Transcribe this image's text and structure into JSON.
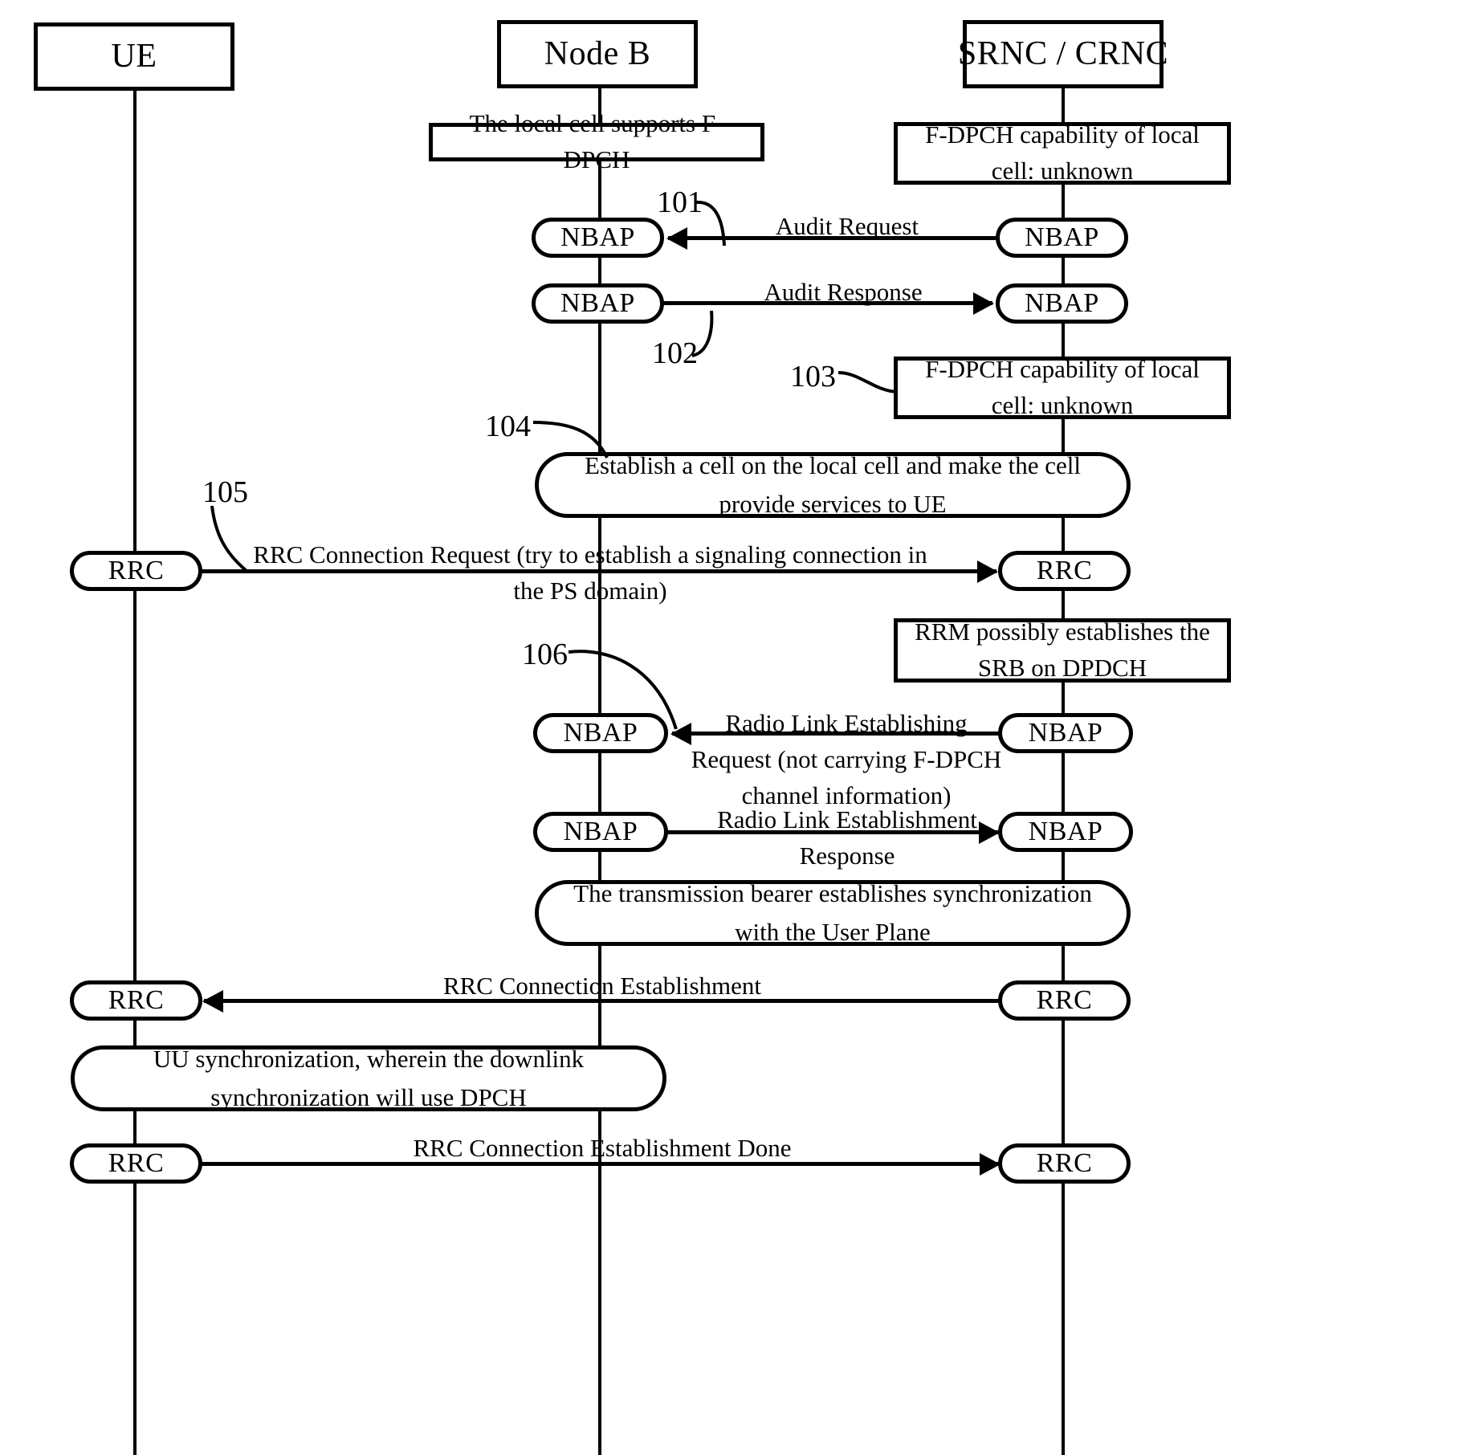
{
  "figure": {
    "type": "sequence-diagram",
    "title": "",
    "background_color": "#ffffff",
    "line_color": "#000000"
  },
  "actors": [
    {
      "id": "ue",
      "label": "UE"
    },
    {
      "id": "nodeb",
      "label": "Node B"
    },
    {
      "id": "rnc",
      "label": "SRNC / CRNC"
    }
  ],
  "notes": [
    {
      "id": "note-nodeb-fdpch",
      "text": "The local cell supports F-DPCH"
    },
    {
      "id": "note-rnc-cap-1",
      "text": "F-DPCH capability of local cell: unknown"
    },
    {
      "id": "note-rnc-cap-2",
      "text": "F-DPCH capability of local cell: unknown"
    },
    {
      "id": "note-rnc-rrm",
      "text": "RRM possibly establishes the SRB on DPDCH"
    }
  ],
  "actions": [
    {
      "id": "action-establish-cell",
      "text": "Establish a cell on the local cell and make the cell provide services to UE"
    },
    {
      "id": "action-transport-sync",
      "text": "The transmission bearer establishes synchronization with the User Plane"
    },
    {
      "id": "action-uu-sync",
      "text": "UU synchronization, wherein the downlink synchronization will use DPCH"
    }
  ],
  "protocol_tags": {
    "nbap": "NBAP",
    "rrc": "RRC"
  },
  "messages": [
    {
      "id": "msg-audit-request",
      "label": "Audit Request",
      "direction": "left",
      "from": "rnc",
      "to": "nodeb",
      "protocol": "NBAP"
    },
    {
      "id": "msg-audit-response",
      "label": "Audit Response",
      "direction": "right",
      "from": "nodeb",
      "to": "rnc",
      "protocol": "NBAP"
    },
    {
      "id": "msg-rrc-conn-request",
      "label": "RRC Connection Request (try to establish a signaling connection in the PS domain)",
      "direction": "right",
      "from": "ue",
      "to": "rnc",
      "protocol": "RRC"
    },
    {
      "id": "msg-rl-establishing",
      "label": "Radio Link Establishing Request (not carrying F-DPCH channel information)",
      "direction": "left",
      "from": "rnc",
      "to": "nodeb",
      "protocol": "NBAP"
    },
    {
      "id": "msg-rl-establishment-response",
      "label": "Radio Link Establishment Response",
      "direction": "right",
      "from": "nodeb",
      "to": "rnc",
      "protocol": "NBAP"
    },
    {
      "id": "msg-rrc-conn-establishment",
      "label": "RRC Connection Establishment",
      "direction": "left",
      "from": "rnc",
      "to": "ue",
      "protocol": "RRC"
    },
    {
      "id": "msg-rrc-conn-establishment-done",
      "label": "RRC Connection Establishment Done",
      "direction": "right",
      "from": "ue",
      "to": "rnc",
      "protocol": "RRC"
    }
  ],
  "reference_numerals": [
    {
      "id": "ref-101",
      "value": "101"
    },
    {
      "id": "ref-102",
      "value": "102"
    },
    {
      "id": "ref-103",
      "value": "103"
    },
    {
      "id": "ref-104",
      "value": "104"
    },
    {
      "id": "ref-105",
      "value": "105"
    },
    {
      "id": "ref-106",
      "value": "106"
    }
  ]
}
